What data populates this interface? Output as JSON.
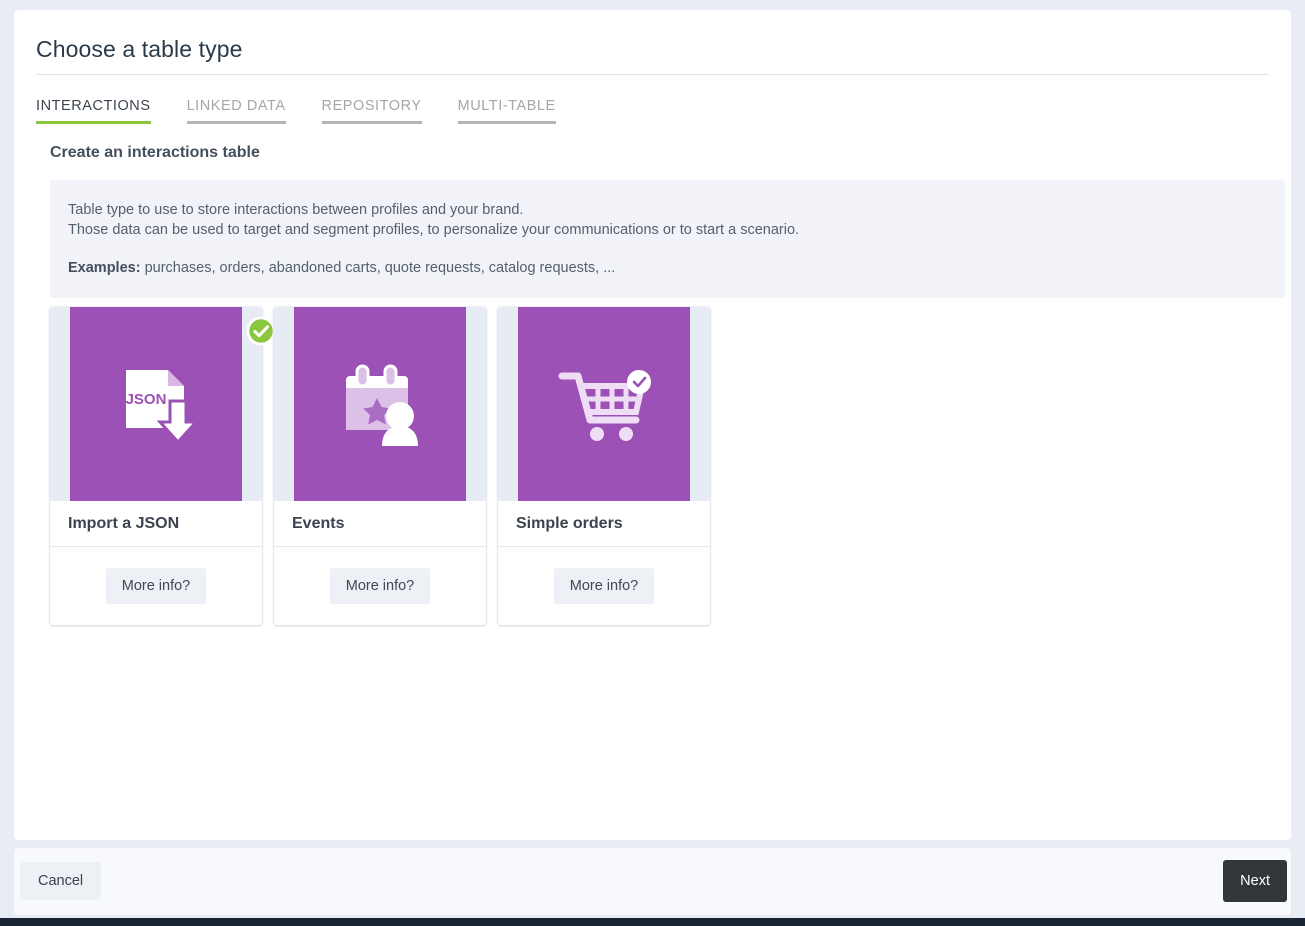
{
  "page": {
    "title": "Choose a table type"
  },
  "tabs": [
    {
      "label": "INTERACTIONS",
      "active": true
    },
    {
      "label": "LINKED DATA",
      "active": false
    },
    {
      "label": "REPOSITORY",
      "active": false
    },
    {
      "label": "MULTI-TABLE",
      "active": false
    }
  ],
  "section": {
    "heading": "Create an interactions table"
  },
  "info": {
    "line1": "Table type to use to store interactions between profiles and your brand.",
    "line2": "Those data can be used to target and segment profiles, to personalize your communications or to start a scenario.",
    "examples_label": "Examples:",
    "examples_value": " purchases, orders, abandoned carts, quote requests, catalog requests, ..."
  },
  "cards": [
    {
      "title": "Import a JSON",
      "more_info_label": "More info?",
      "icon": "json-file-download-icon",
      "selected": true,
      "badge": "check-circle-icon"
    },
    {
      "title": "Events",
      "more_info_label": "More info?",
      "icon": "calendar-person-star-icon",
      "selected": false
    },
    {
      "title": "Simple orders",
      "more_info_label": "More info?",
      "icon": "shopping-cart-check-icon",
      "selected": false
    }
  ],
  "footer": {
    "cancel_label": "Cancel",
    "next_label": "Next"
  },
  "colors": {
    "accent_green": "#8bc63f",
    "thumb_purple": "#9b51b5",
    "page_bg": "#e8ecf5",
    "info_bg": "#f1f3f8",
    "next_bg": "#32363b",
    "bottom_bar": "#1b2433"
  }
}
